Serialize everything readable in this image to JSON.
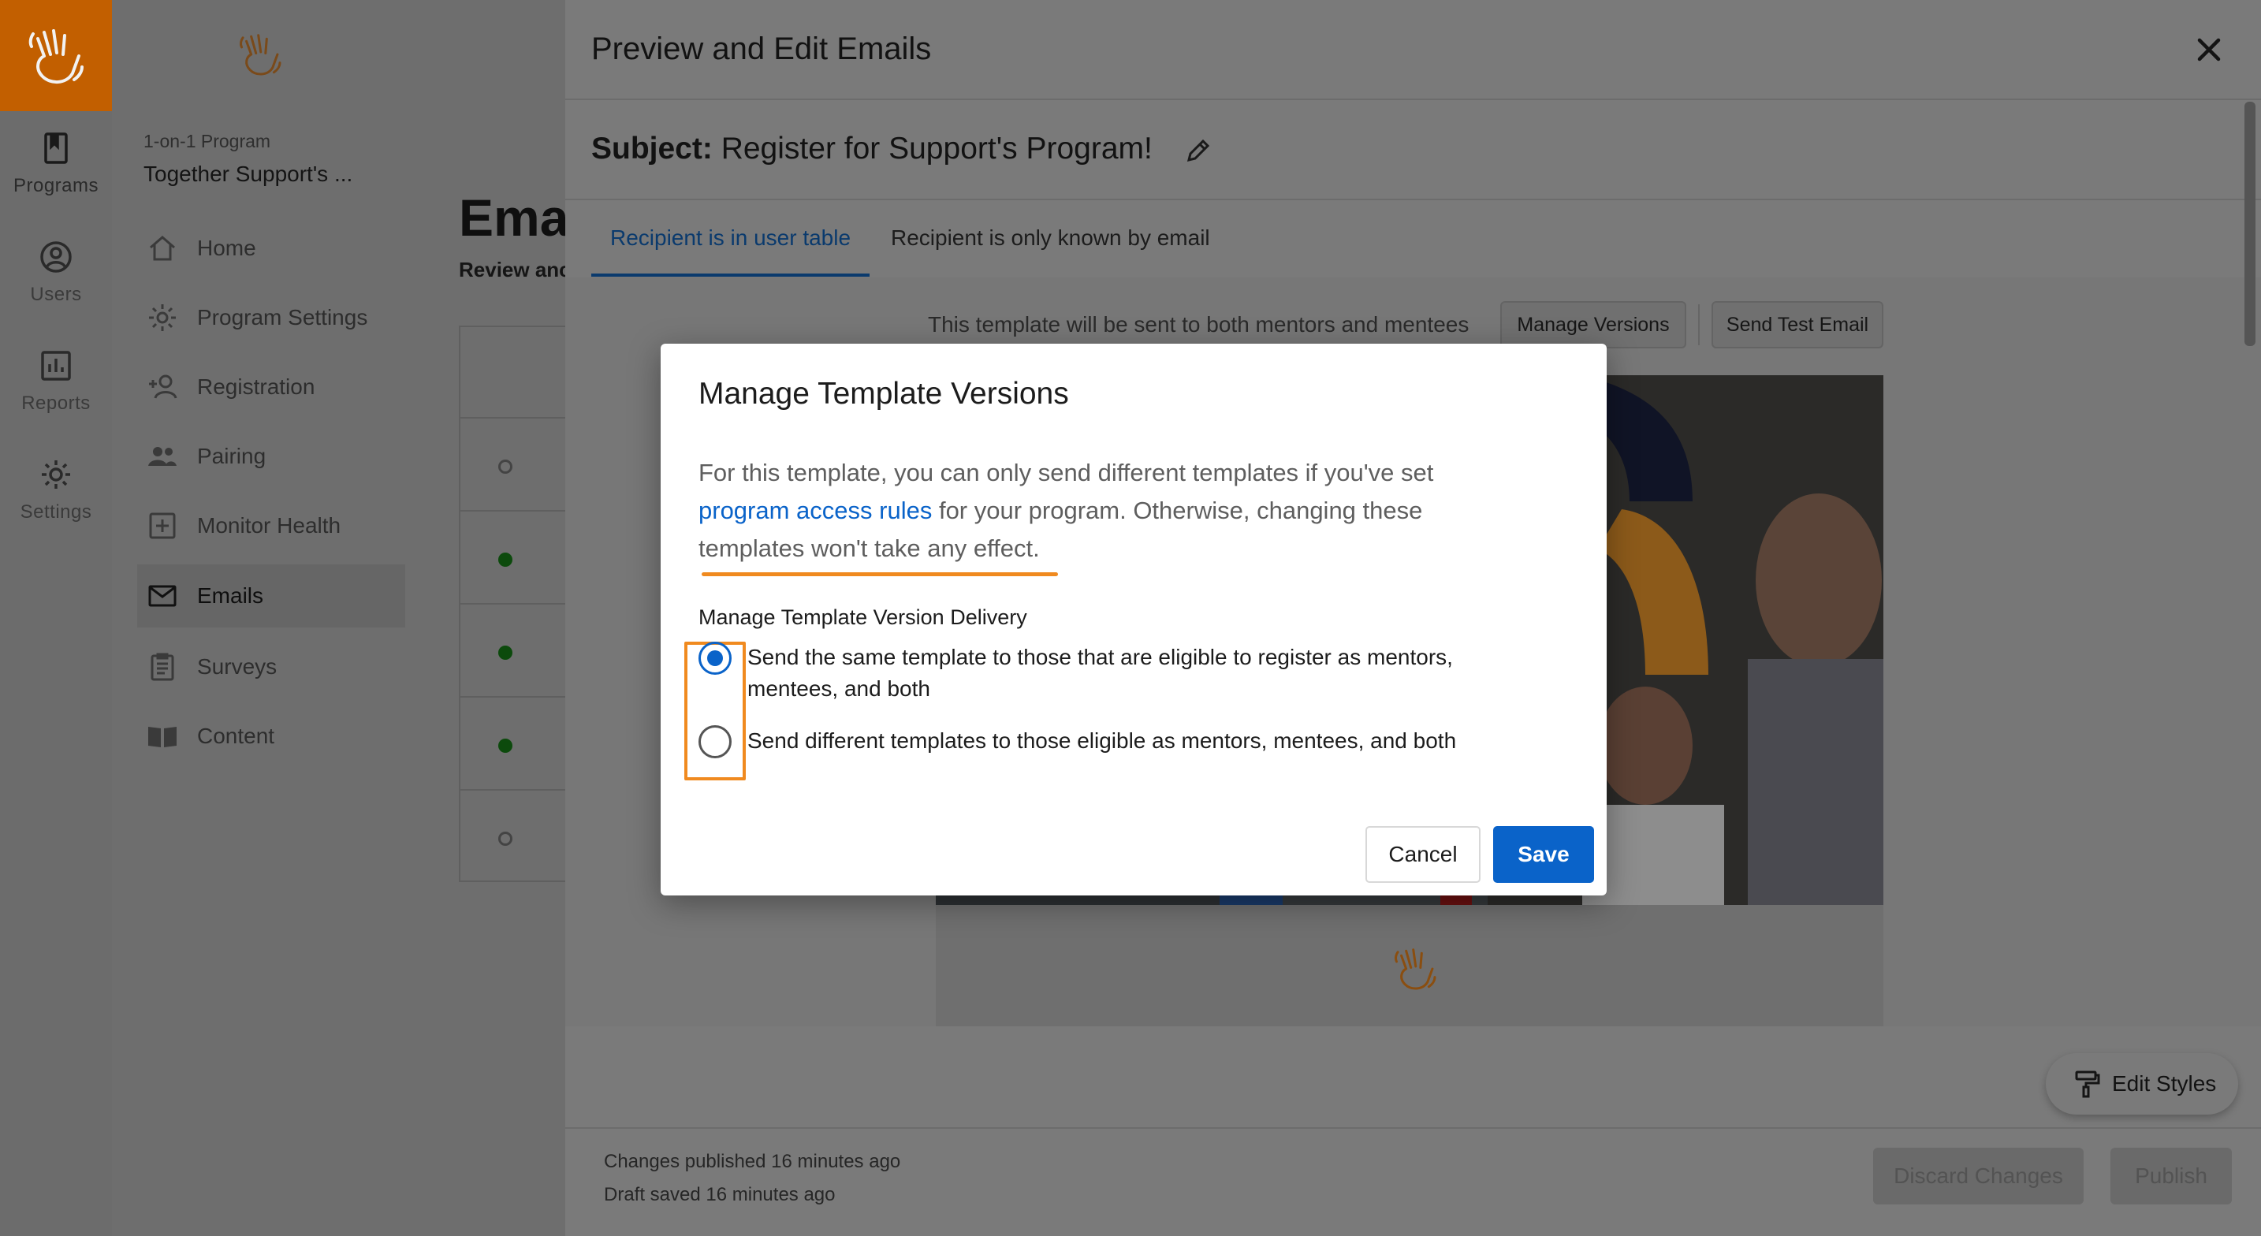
{
  "rail": {
    "items": [
      {
        "label": "Programs",
        "icon": "book-icon"
      },
      {
        "label": "Users",
        "icon": "user-circle-icon"
      },
      {
        "label": "Reports",
        "icon": "bar-chart-icon"
      },
      {
        "label": "Settings",
        "icon": "gear-icon"
      }
    ]
  },
  "nav": {
    "kicker": "1-on-1 Program",
    "title": "Together Support's ...",
    "items": [
      {
        "label": "Home",
        "icon": "home-icon"
      },
      {
        "label": "Program Settings",
        "icon": "gear-icon"
      },
      {
        "label": "Registration",
        "icon": "add-person-icon"
      },
      {
        "label": "Pairing",
        "icon": "people-icon"
      },
      {
        "label": "Monitor Health",
        "icon": "plus-square-icon"
      },
      {
        "label": "Emails",
        "icon": "envelope-icon"
      },
      {
        "label": "Surveys",
        "icon": "clipboard-icon"
      },
      {
        "label": "Content",
        "icon": "book-open-icon"
      }
    ],
    "active": "Emails"
  },
  "main": {
    "title": "Ema",
    "subtitle": "Review anc"
  },
  "drawer": {
    "title": "Preview and Edit Emails",
    "subject_prefix": "Subject:",
    "subject_text": "Register for Support's Program!",
    "tabs": [
      {
        "label": "Recipient is in user table",
        "active": true
      },
      {
        "label": "Recipient is only known by email",
        "active": false
      }
    ],
    "template_note": "This template will be sent to both mentors and mentees",
    "manage_versions_label": "Manage Versions",
    "send_test_label": "Send Test Email",
    "edit_styles_label": "Edit Styles",
    "footer": {
      "published": "Changes published 16 minutes ago",
      "draft": "Draft saved 16 minutes ago",
      "discard_label": "Discard Changes",
      "publish_label": "Publish"
    }
  },
  "modal": {
    "title": "Manage Template Versions",
    "body_before_link": "For this template, you can only send different templates if you've set ",
    "link_text": "program access rules",
    "body_after_link": " for your program. Otherwise, changing these templates won't take any effect.",
    "radio_heading": "Manage Template Version Delivery",
    "options": [
      {
        "label": "Send the same template to those that are eligible to register as mentors, mentees, and both",
        "checked": true
      },
      {
        "label": "Send different templates to those eligible as mentors, mentees, and both",
        "checked": false
      }
    ],
    "cancel_label": "Cancel",
    "save_label": "Save"
  },
  "colors": {
    "brand_orange": "#c25f00",
    "accent_blue": "#0a63c9",
    "highlight_orange": "#f08a1f",
    "status_green": "#0c4a0c"
  }
}
